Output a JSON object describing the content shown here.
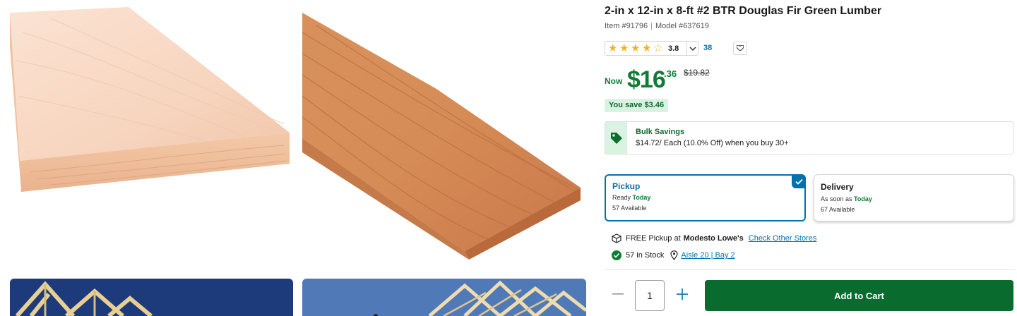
{
  "product": {
    "title": "2-in x 12-in x 8-ft #2 BTR Douglas Fir Green Lumber",
    "item_number": "Item #91796",
    "model_number": "Model #637619"
  },
  "rating": {
    "value": "3.8",
    "stars_value": 3.8,
    "review_count": "38"
  },
  "price": {
    "now_label": "Now",
    "dollars": "$16",
    "cents": ".36",
    "was_price": "$19.82",
    "savings": "You save $3.46"
  },
  "bulk_savings": {
    "title": "Bulk Savings",
    "description": "$14.72/ Each (10.0% Off) when you buy 30+"
  },
  "fulfillment": {
    "pickup": {
      "title": "Pickup",
      "ready_prefix": "Ready",
      "ready_day": "Today",
      "available": "57 Available",
      "selected": true
    },
    "delivery": {
      "title": "Delivery",
      "soon_prefix": "As soon as",
      "soon_day": "Today",
      "available": "67 Available",
      "selected": false
    }
  },
  "store": {
    "free_pickup_prefix": "FREE Pickup at",
    "store_name": "Modesto Lowe's",
    "check_other_stores": "Check Other Stores",
    "stock_text": "57 in Stock",
    "aisle_text": "Aisle 20 | Bay 2"
  },
  "cart": {
    "quantity": "1",
    "add_to_cart_label": "Add to Cart"
  },
  "colors": {
    "price_green": "#0f7b35",
    "link_blue": "#0471af",
    "cart_green": "#0a6b2e",
    "star_gold": "#f0b323"
  },
  "icons": [
    "heart-icon",
    "chevron-down-icon",
    "tag-icon",
    "checkmark-icon",
    "store-box-icon",
    "in-stock-check-icon",
    "location-pin-icon",
    "minus-icon",
    "plus-icon"
  ]
}
